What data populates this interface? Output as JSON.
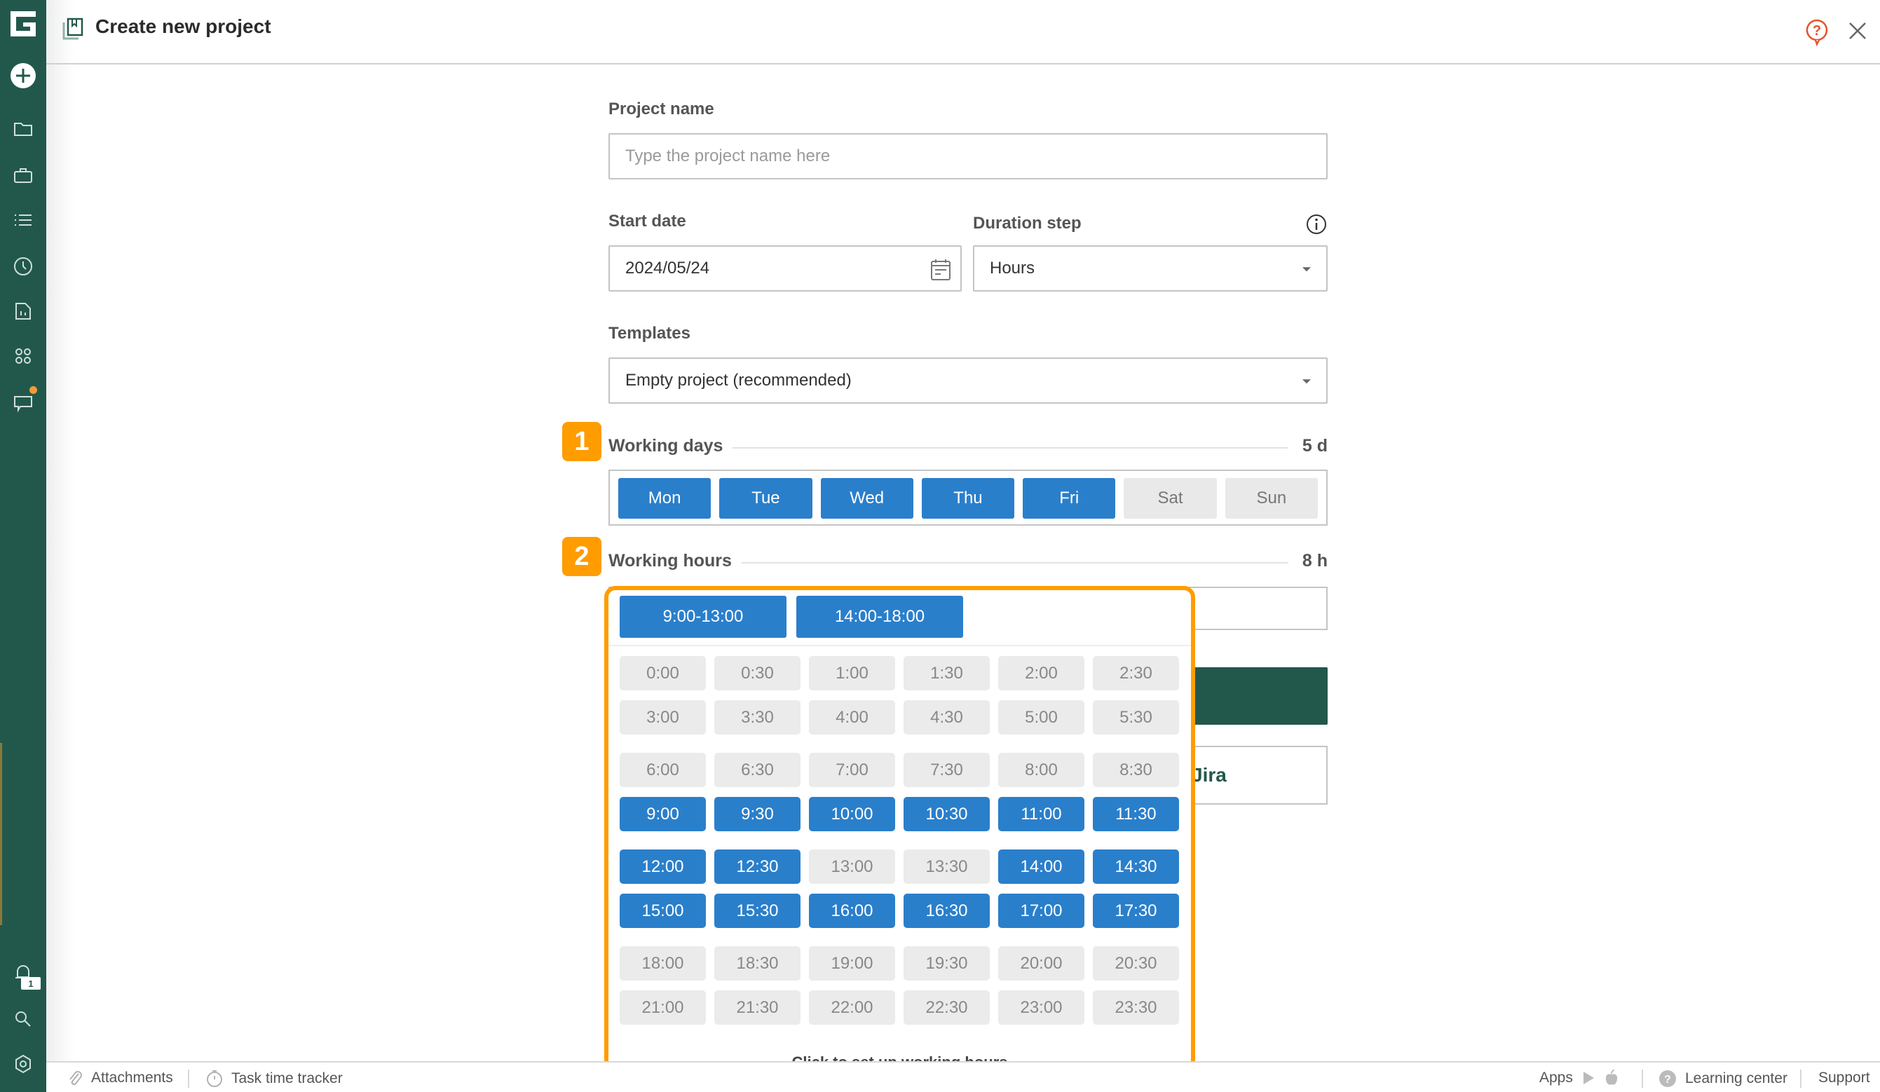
{
  "header": {
    "title": "Create new project",
    "icons": {
      "project": "project-book-icon",
      "help": "help-bubble-icon",
      "close": "close-icon"
    }
  },
  "sidebar": {
    "items": [
      {
        "name": "logo",
        "icon": "app-logo-icon"
      },
      {
        "name": "create",
        "icon": "plus-circle-icon"
      },
      {
        "name": "projects",
        "icon": "folder-icon"
      },
      {
        "name": "portfolios",
        "icon": "briefcase-icon"
      },
      {
        "name": "tasks",
        "icon": "list-icon"
      },
      {
        "name": "time",
        "icon": "clock-icon"
      },
      {
        "name": "reports",
        "icon": "report-icon"
      },
      {
        "name": "apps",
        "icon": "grid-icon"
      },
      {
        "name": "chat",
        "icon": "chat-icon",
        "has_dot": true
      },
      {
        "name": "notifications",
        "icon": "bell-icon",
        "badge": "1"
      },
      {
        "name": "search",
        "icon": "search-icon"
      },
      {
        "name": "settings",
        "icon": "gear-icon"
      }
    ]
  },
  "form": {
    "project_name": {
      "label": "Project name",
      "value": "",
      "placeholder": "Type the project name here"
    },
    "start_date": {
      "label": "Start date",
      "value": "2024/05/24"
    },
    "duration_step": {
      "label": "Duration step",
      "value": "Hours"
    },
    "templates": {
      "label": "Templates",
      "value": "Empty project (recommended)"
    },
    "working_days": {
      "badge": "1",
      "label": "Working days",
      "total": "5 d",
      "days": [
        {
          "label": "Mon",
          "selected": true
        },
        {
          "label": "Tue",
          "selected": true
        },
        {
          "label": "Wed",
          "selected": true
        },
        {
          "label": "Thu",
          "selected": true
        },
        {
          "label": "Fri",
          "selected": true
        },
        {
          "label": "Sat",
          "selected": false
        },
        {
          "label": "Sun",
          "selected": false
        }
      ]
    },
    "working_hours": {
      "badge": "2",
      "label": "Working hours",
      "total": "8 h"
    },
    "jira_button_partial": "Jira"
  },
  "hours_popover": {
    "ranges": [
      "9:00-13:00",
      "14:00-18:00"
    ],
    "rows": [
      [
        [
          "0:00",
          false
        ],
        [
          "0:30",
          false
        ],
        [
          "1:00",
          false
        ],
        [
          "1:30",
          false
        ],
        [
          "2:00",
          false
        ],
        [
          "2:30",
          false
        ]
      ],
      [
        [
          "3:00",
          false
        ],
        [
          "3:30",
          false
        ],
        [
          "4:00",
          false
        ],
        [
          "4:30",
          false
        ],
        [
          "5:00",
          false
        ],
        [
          "5:30",
          false
        ]
      ],
      [
        [
          "6:00",
          false
        ],
        [
          "6:30",
          false
        ],
        [
          "7:00",
          false
        ],
        [
          "7:30",
          false
        ],
        [
          "8:00",
          false
        ],
        [
          "8:30",
          false
        ]
      ],
      [
        [
          "9:00",
          true
        ],
        [
          "9:30",
          true
        ],
        [
          "10:00",
          true
        ],
        [
          "10:30",
          true
        ],
        [
          "11:00",
          true
        ],
        [
          "11:30",
          true
        ]
      ],
      [
        [
          "12:00",
          true
        ],
        [
          "12:30",
          true
        ],
        [
          "13:00",
          false
        ],
        [
          "13:30",
          false
        ],
        [
          "14:00",
          true
        ],
        [
          "14:30",
          true
        ]
      ],
      [
        [
          "15:00",
          true
        ],
        [
          "15:30",
          true
        ],
        [
          "16:00",
          true
        ],
        [
          "16:30",
          true
        ],
        [
          "17:00",
          true
        ],
        [
          "17:30",
          true
        ]
      ],
      [
        [
          "18:00",
          false
        ],
        [
          "18:30",
          false
        ],
        [
          "19:00",
          false
        ],
        [
          "19:30",
          false
        ],
        [
          "20:00",
          false
        ],
        [
          "20:30",
          false
        ]
      ],
      [
        [
          "21:00",
          false
        ],
        [
          "21:30",
          false
        ],
        [
          "22:00",
          false
        ],
        [
          "22:30",
          false
        ],
        [
          "23:00",
          false
        ],
        [
          "23:30",
          false
        ]
      ]
    ],
    "footer": "Click to set up working hours"
  },
  "bottombar": {
    "attachments": "Attachments",
    "time_tracker": "Task time tracker",
    "apps": "Apps",
    "learning_center": "Learning center",
    "support": "Support"
  },
  "colors": {
    "brand": "#22584b",
    "selected": "#2a7fcb",
    "unselected": "#e9e9e9",
    "highlight": "#ff9c00",
    "notification_dot": "#f39a3a",
    "help": "#e8532d"
  }
}
